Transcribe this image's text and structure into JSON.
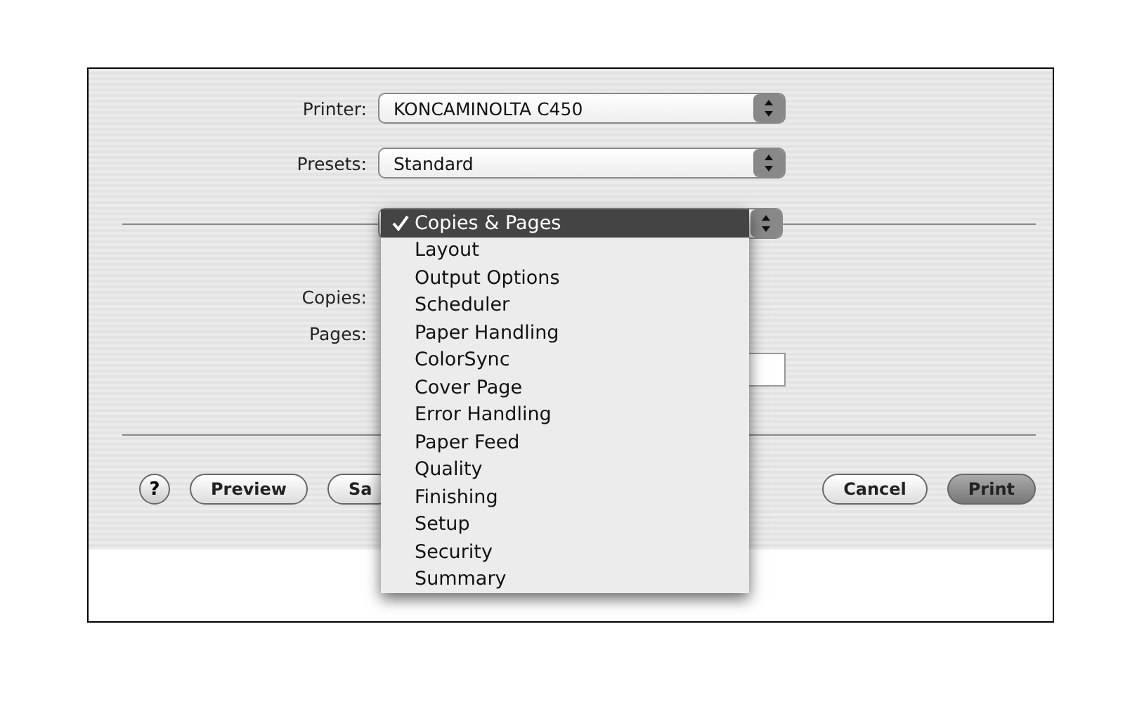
{
  "printer": {
    "label": "Printer:",
    "value": "KONCAMINOLTA C450"
  },
  "presets": {
    "label": "Presets:",
    "value": "Standard"
  },
  "panel_menu": {
    "items": [
      {
        "label": "Copies & Pages",
        "selected": true
      },
      {
        "label": "Layout",
        "selected": false
      },
      {
        "label": "Output Options",
        "selected": false
      },
      {
        "label": "Scheduler",
        "selected": false
      },
      {
        "label": "Paper Handling",
        "selected": false
      },
      {
        "label": "ColorSync",
        "selected": false
      },
      {
        "label": "Cover Page",
        "selected": false
      },
      {
        "label": "Error Handling",
        "selected": false
      },
      {
        "label": "Paper Feed",
        "selected": false
      },
      {
        "label": "Quality",
        "selected": false
      },
      {
        "label": "Finishing",
        "selected": false
      },
      {
        "label": "Setup",
        "selected": false
      },
      {
        "label": "Security",
        "selected": false
      },
      {
        "label": "Summary",
        "selected": false
      }
    ]
  },
  "copies": {
    "label": "Copies:"
  },
  "pages": {
    "label": "Pages:"
  },
  "buttons": [
    {
      "kind": "help",
      "label": "?"
    },
    {
      "kind": "normal",
      "label": "Preview"
    },
    {
      "kind": "normal",
      "label": "Sa"
    },
    {
      "kind": "spacer"
    },
    {
      "kind": "normal",
      "label": "Cancel"
    },
    {
      "kind": "default",
      "label": "Print"
    }
  ]
}
